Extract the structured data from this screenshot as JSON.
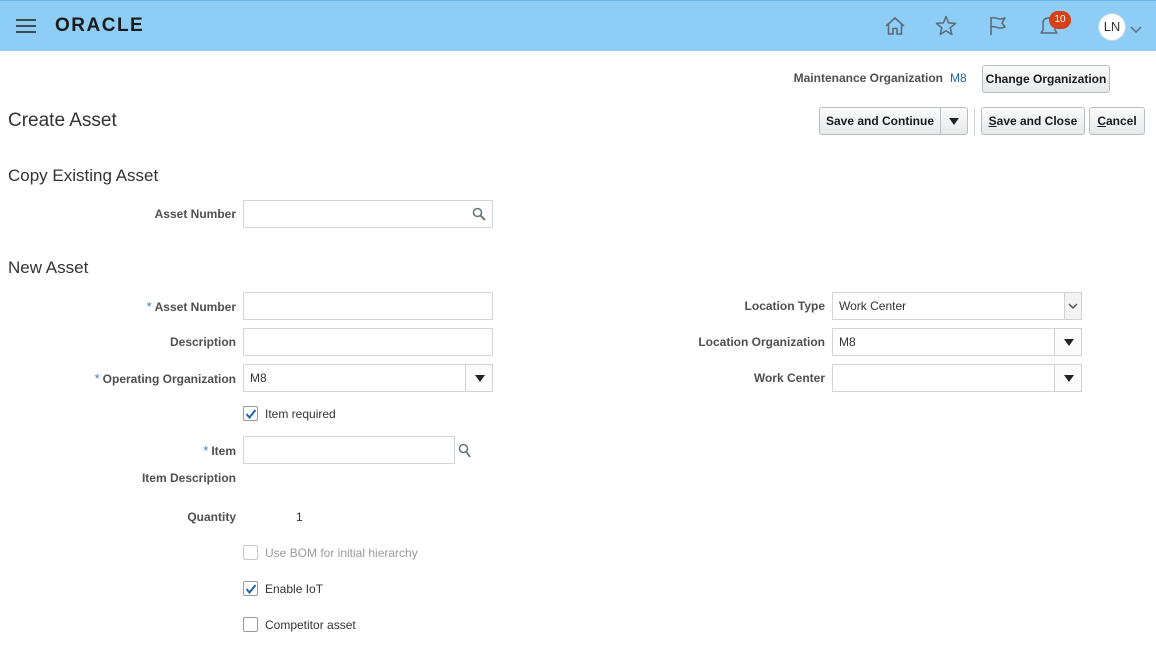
{
  "header": {
    "logo": "ORACLE",
    "notification_count": "10",
    "user_initials": "LN"
  },
  "org": {
    "label": "Maintenance Organization",
    "value": "M8",
    "change_button": "Change Organization"
  },
  "page_title": "Create Asset",
  "actions": {
    "save_continue": "Save and Continue",
    "save_close_prefix": "S",
    "save_close_rest": "ave and Close",
    "cancel_prefix": "C",
    "cancel_rest": "ancel"
  },
  "copy_section": {
    "title": "Copy Existing Asset",
    "asset_number_label": "Asset Number",
    "asset_number_value": ""
  },
  "new_section": {
    "title": "New Asset",
    "asset_number_label": "Asset Number",
    "asset_number_value": "",
    "description_label": "Description",
    "description_value": "",
    "operating_org_label": "Operating Organization",
    "operating_org_value": "M8",
    "item_required_label": "Item required",
    "item_label": "Item",
    "item_value": "",
    "item_description_label": "Item Description",
    "quantity_label": "Quantity",
    "quantity_value": "1",
    "use_bom_label": "Use BOM for initial hierarchy",
    "enable_iot_label": "Enable IoT",
    "competitor_label": "Competitor asset",
    "location_type_label": "Location Type",
    "location_type_value": "Work Center",
    "location_org_label": "Location Organization",
    "location_org_value": "M8",
    "work_center_label": "Work Center",
    "work_center_value": ""
  },
  "checkboxes": {
    "item_required": true,
    "use_bom": false,
    "enable_iot": true,
    "competitor_asset": false
  },
  "icons": [
    "hamburger-icon",
    "home-icon",
    "star-icon",
    "flag-icon",
    "notifications-icon",
    "chevron-down-icon",
    "search-icon",
    "dropdown-arrow-icon",
    "checkmark-icon"
  ],
  "colors": {
    "topbar": "#8ecdf6",
    "badge": "#d54018",
    "link": "#1f66ad",
    "required": "#3a7fbd"
  }
}
